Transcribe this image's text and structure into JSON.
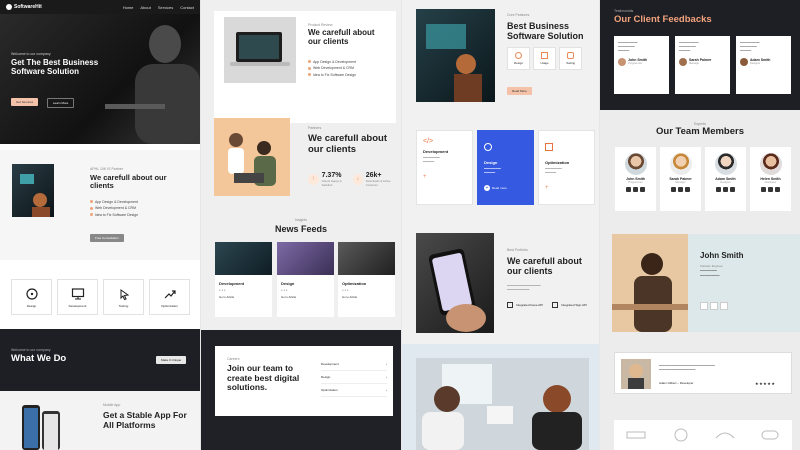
{
  "brand": {
    "name": "SoftwareHit",
    "accent": "#f3a37d",
    "blue": "#3559e0",
    "dark": "#1e1f24"
  },
  "nav": {
    "links": [
      "Home",
      "About",
      "Services",
      "Contact"
    ]
  },
  "col1": {
    "hero_kicker": "Welcome to our company",
    "hero_title": "Get The Best Business Software Solution",
    "hero_btn1": "Get Services",
    "hero_btn2": "Learn More",
    "about_kicker": "APHL 10K IS Partner",
    "about_title": "We carefull about our clients",
    "about_checks": [
      "App Design & Development",
      "Web Development & CRM",
      "Idea to Fix Software Design"
    ],
    "about_btn": "Free Consultation",
    "services": [
      "Design",
      "Development",
      "Testing",
      "Optimization"
    ],
    "what_kicker": "Welcome to our company",
    "what_title": "What We Do",
    "what_btn": "Make It Unique",
    "app_kicker": "Mobile App",
    "app_title": "Get a Stable App For All Platforms"
  },
  "col2": {
    "sec1_kicker": "Product Review",
    "sec1_title": "We carefull about our clients",
    "sec1_checks": [
      "App Design & Development",
      "Web Development & CRM",
      "Idea to Fix Software Design"
    ],
    "sec2_kicker": "Partners",
    "sec2_title": "We carefull about our clients",
    "stat1_value": "7.37%",
    "stat1_label": "Clients Happy & Satisfied",
    "stat2_value": "26k+",
    "stat2_label": "Downloads & Active Customer",
    "news_kicker": "Insights",
    "news_title": "News Feeds",
    "news": [
      {
        "title": "Development",
        "link": "Go to Article"
      },
      {
        "title": "Design",
        "link": "Go to Article"
      },
      {
        "title": "Optimization",
        "link": "Go to Article"
      }
    ],
    "join_kicker": "Careers",
    "join_title": "Join our team to create best digital solutions.",
    "jobs": [
      "Development",
      "Design",
      "Optimization"
    ]
  },
  "col3": {
    "top_kicker": "Core Features",
    "top_title": "Best Business Software Solution",
    "top_icons": [
      "Design",
      "Usage",
      "Testing"
    ],
    "top_btn": "Read More",
    "services": [
      {
        "title": "Development"
      },
      {
        "title": "Design",
        "btn": "Read more"
      },
      {
        "title": "Optimization"
      }
    ],
    "mid_kicker": "Best Portfolio",
    "mid_title": "We carefull about our clients",
    "mid_feat1": "Integrated Issue API",
    "mid_feat2": "Integrated Sign API"
  },
  "col4": {
    "fb_kicker": "Testimonials",
    "fb_title": "Our Client Feedbacks",
    "feedbacks": [
      {
        "name": "John Smith",
        "role": "Programmer"
      },
      {
        "name": "Sarah Palmer",
        "role": "Manager"
      },
      {
        "name": "Adam Smith",
        "role": "Designer"
      }
    ],
    "team_kicker": "Experts",
    "team_title": "Our Team Members",
    "team": [
      {
        "name": "John Smith",
        "role": "Programmer"
      },
      {
        "name": "Sarah Palmer",
        "role": "Manager"
      },
      {
        "name": "Adam Smith",
        "role": "Designer"
      },
      {
        "name": "Helen Smith",
        "role": "Developer"
      }
    ],
    "profile_name": "John Smith",
    "profile_role": "Software Engineer",
    "testimonial_name": "Adam Gilbert – Developer"
  }
}
